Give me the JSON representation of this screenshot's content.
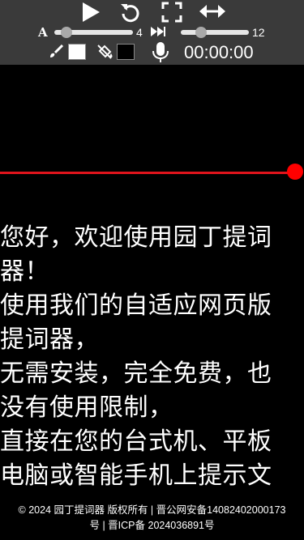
{
  "toolbar": {
    "font_size_glyph": "A",
    "font_size_value": "4",
    "speed_value": "12",
    "font_size_level": 0.1,
    "speed_level": 0.25,
    "text_color": "#ffffff",
    "bg_color": "#000000",
    "timer": "00:00:00"
  },
  "guide": {
    "color": "#e0141c"
  },
  "script_lines": [
    "您好，欢迎使用园丁提词器！",
    "使用我们的自适应网页版提词器，",
    "无需安装，完全免费，也没有使用限制，",
    "直接在您的台式机、平板电脑或智能手机上提示文"
  ],
  "footer": {
    "line1": "© 2024 园丁提词器 版权所有 | 晋公网安备14082402000173",
    "line2": "号 | 晋ICP备 2024036891号"
  },
  "icons": [
    "play-icon",
    "restart-icon",
    "fullscreen-icon",
    "mirror-icon",
    "font-size-icon",
    "speed-icon",
    "brush-icon",
    "paint-bucket-icon",
    "microphone-icon"
  ]
}
